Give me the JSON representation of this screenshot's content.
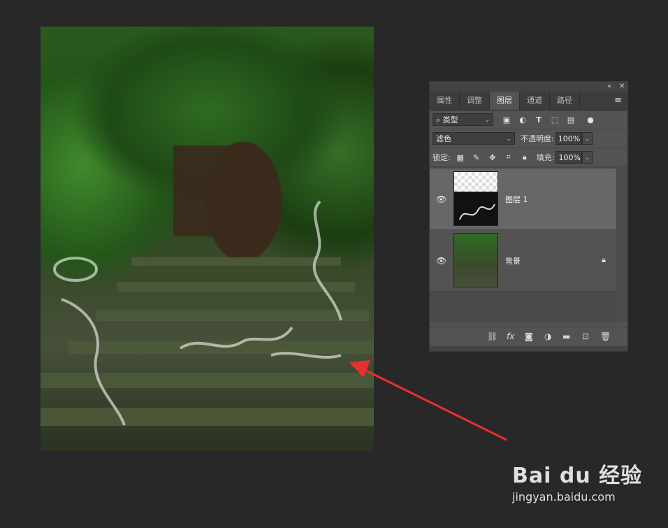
{
  "panel": {
    "tabs": [
      {
        "label": "属性"
      },
      {
        "label": "调整"
      },
      {
        "label": "图层"
      },
      {
        "label": "通道"
      },
      {
        "label": "路径"
      }
    ],
    "filter_label": "类型",
    "blend_mode": "滤色",
    "opacity_label": "不透明度:",
    "opacity_value": "100%",
    "lock_label": "锁定:",
    "fill_label": "填充:",
    "fill_value": "100%",
    "layers": [
      {
        "name": "图层 1",
        "selected": true,
        "visible": true
      },
      {
        "name": "背景",
        "selected": false,
        "visible": true,
        "locked": true
      }
    ],
    "bottom_icons": [
      "link-icon",
      "fx-icon",
      "mask-icon",
      "adjustment-icon",
      "folder-icon",
      "new-layer-icon",
      "trash-icon"
    ]
  },
  "watermark": {
    "brand": "Bai du 经验",
    "url": "jingyan.baidu.com"
  },
  "colors": {
    "arrow": "#e8302e",
    "panel_bg": "#535353",
    "selected_layer": "#676767",
    "workspace": "#282828"
  }
}
